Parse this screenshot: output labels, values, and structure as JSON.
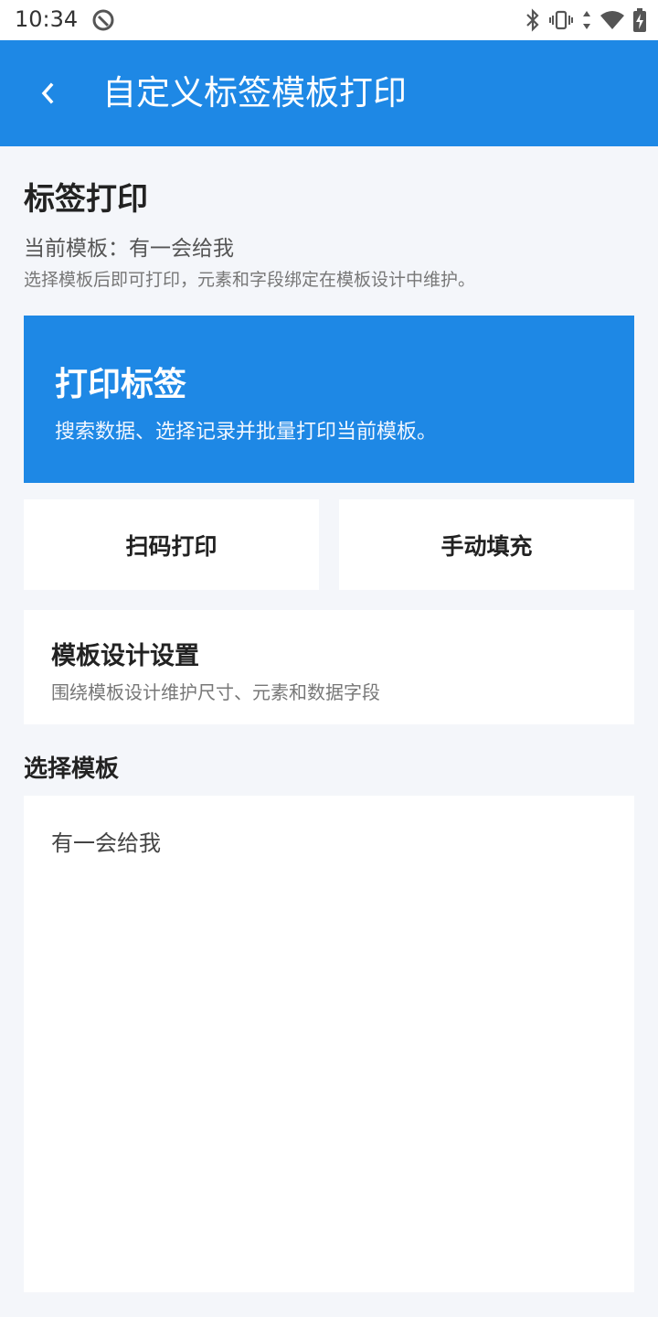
{
  "status_bar": {
    "time": "10:34",
    "icons": [
      "app-notification-icon",
      "bluetooth-icon",
      "vibrate-icon",
      "data-arrows-icon",
      "wifi-icon",
      "battery-charging-icon"
    ]
  },
  "app_bar": {
    "title": "自定义标签模板打印",
    "back_icon": "chevron-left-icon"
  },
  "header": {
    "title": "标签打印",
    "current_template": "当前模板：有一会给我",
    "hint": "选择模板后即可打印，元素和字段绑定在模板设计中维护。"
  },
  "print_card": {
    "title": "打印标签",
    "description": "搜索数据、选择记录并批量打印当前模板。"
  },
  "actions": {
    "scan_print": "扫码打印",
    "manual_fill": "手动填充"
  },
  "design_card": {
    "title": "模板设计设置",
    "description": "围绕模板设计维护尺寸、元素和数据字段"
  },
  "template_section": {
    "label": "选择模板",
    "items": [
      {
        "label": "有一会给我"
      }
    ]
  },
  "colors": {
    "primary": "#1e88e5",
    "background": "#f4f6fa",
    "card": "#ffffff"
  }
}
